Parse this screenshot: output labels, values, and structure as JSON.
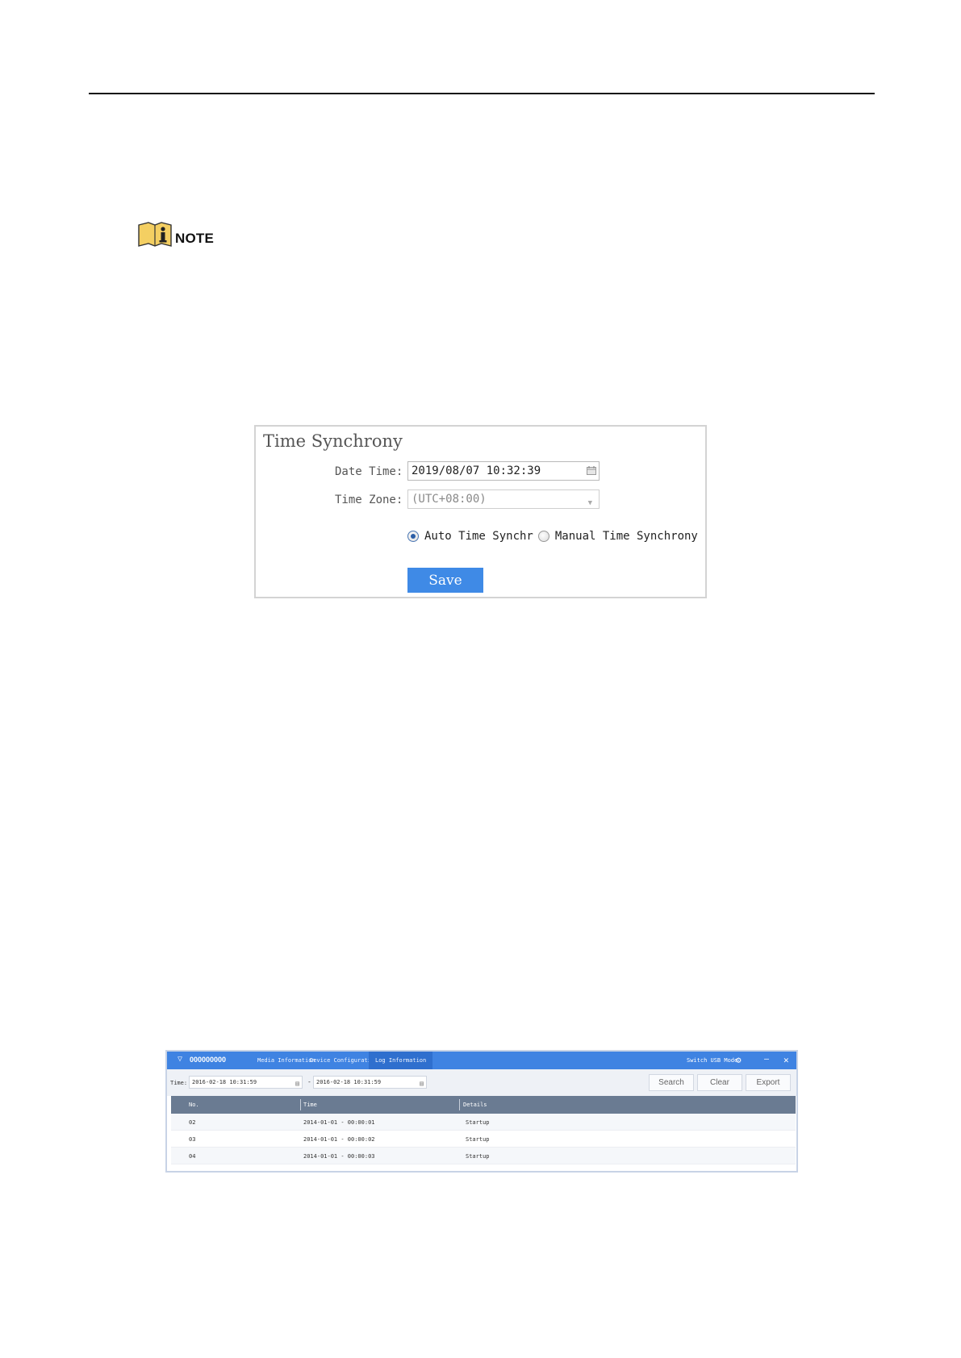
{
  "note": {
    "label": "NOTE",
    "icon": "info-book-icon"
  },
  "time_sync": {
    "title": "Time Synchrony",
    "date_time_label": "Date Time:",
    "date_time_value": "2019/08/07 10:32:39",
    "time_zone_label": "Time Zone:",
    "time_zone_value": "(UTC+08:00)",
    "auto_label": "Auto Time Synchr",
    "manual_label": "Manual Time Synchrony",
    "selected_mode": "auto",
    "save_label": "Save",
    "save_color": "#3f8ae6"
  },
  "log_window": {
    "device_name": "000000000",
    "tabs": [
      "Media Information",
      "Device Configuration",
      "Log Information"
    ],
    "active_tab": "Log Information",
    "switch_mode_label": "Switch USB Mode",
    "titlebar_color": "#3f83e2",
    "filter": {
      "time_label": "Time:",
      "start": "2016-02-18 10:31:59",
      "separator": "-",
      "end": "2016-02-18 10:31:59",
      "search_label": "Search",
      "clear_label": "Clear",
      "export_label": "Export"
    },
    "columns": [
      "No.",
      "Time",
      "Details"
    ],
    "rows": [
      {
        "no": "02",
        "time": "2014-01-01 - 00:00:01",
        "details": "Startup"
      },
      {
        "no": "03",
        "time": "2014-01-01 - 00:00:02",
        "details": "Startup"
      },
      {
        "no": "04",
        "time": "2014-01-01 - 00:00:03",
        "details": "Startup"
      }
    ]
  }
}
